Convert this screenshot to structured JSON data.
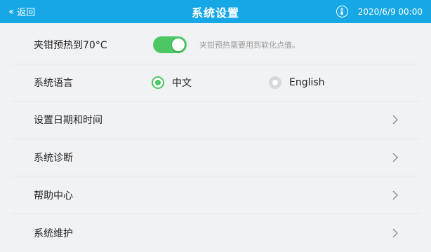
{
  "header": {
    "back_icon": "double-chevron-left-icon",
    "back_label": "返回",
    "title": "系统设置",
    "thermometer_icon": "thermometer-icon",
    "datetime": "2020/6/9  00:00"
  },
  "settings": {
    "preheat": {
      "label": "夹钳预热到70°C",
      "enabled": true,
      "hint": "夹钳预热需要用到软化点值。"
    },
    "language": {
      "label": "系统语言",
      "options": [
        {
          "label": "中文",
          "selected": true
        },
        {
          "label": "English",
          "selected": false
        }
      ]
    },
    "date_time": {
      "label": "设置日期和时间",
      "icon": "chevron-right-icon"
    },
    "diagnostics": {
      "label": "系统诊断",
      "icon": "chevron-right-icon"
    },
    "help": {
      "label": "帮助中心",
      "icon": "chevron-right-icon"
    },
    "maintenance": {
      "label": "系统维护",
      "icon": "chevron-right-icon"
    }
  },
  "colors": {
    "header_bg": "#16a7e6",
    "accent_green": "#4cc764",
    "page_bg": "#f1f2f4"
  }
}
